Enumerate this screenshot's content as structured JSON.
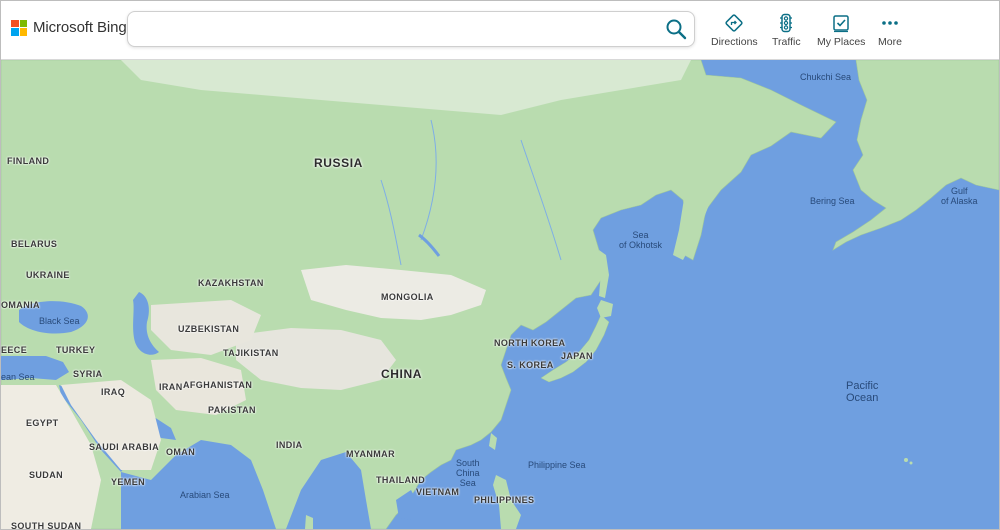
{
  "brand": {
    "name": "Microsoft Bing",
    "logo_colors": [
      "#f25022",
      "#7fba00",
      "#00a4ef",
      "#ffb900"
    ]
  },
  "search": {
    "value": "",
    "placeholder": ""
  },
  "accent_color": "#0b6f86",
  "toolbar": {
    "directions": {
      "label": "Directions",
      "icon": "directions-icon"
    },
    "traffic": {
      "label": "Traffic",
      "icon": "traffic-light-icon"
    },
    "my_places": {
      "label": "My Places",
      "icon": "my-places-icon"
    },
    "more": {
      "label": "More",
      "icon": "more-dots-icon"
    }
  },
  "map": {
    "water_color": "#6f9fe0",
    "land_color": "#b8dcae",
    "labels": {
      "russia": "RUSSIA",
      "finland": "FINLAND",
      "belarus": "BELARUS",
      "ukraine": "UKRAINE",
      "romania": "OMANIA",
      "kazakhstan": "KAZAKHSTAN",
      "mongolia": "MONGOLIA",
      "uzbekistan": "UZBEKISTAN",
      "tajikistan": "TAJIKISTAN",
      "turkey": "TURKEY",
      "greece": "EECE",
      "syria": "SYRIA",
      "iraq": "IRAQ",
      "iran": "IRAN",
      "afghanistan": "AFGHANISTAN",
      "pakistan": "PAKISTAN",
      "china": "CHINA",
      "north_korea": "NORTH KOREA",
      "south_korea": "S. KOREA",
      "japan": "JAPAN",
      "india": "INDIA",
      "egypt": "EGYPT",
      "saudi_arabia": "SAUDI ARABIA",
      "oman": "OMAN",
      "yemen": "YEMEN",
      "sudan": "SUDAN",
      "south_sudan": "SOUTH SUDAN",
      "myanmar": "MYANMAR",
      "thailand": "THAILAND",
      "vietnam": "VIETNAM",
      "philippines": "PHILIPPINES",
      "black_sea": "Black Sea",
      "mediterranean": "ean Sea",
      "arabian_sea": "Arabian Sea",
      "south_china_sea": [
        "South",
        "China",
        "Sea"
      ],
      "philippine_sea": "Philippine Sea",
      "sea_of_okhotsk": [
        "Sea",
        "of Okhotsk"
      ],
      "bering_sea": "Bering Sea",
      "chukchi_sea": "Chukchi Sea",
      "gulf_of_alaska": [
        "Gulf",
        "of Alaska"
      ],
      "pacific_ocean": [
        "Pacific",
        "Ocean"
      ]
    }
  }
}
